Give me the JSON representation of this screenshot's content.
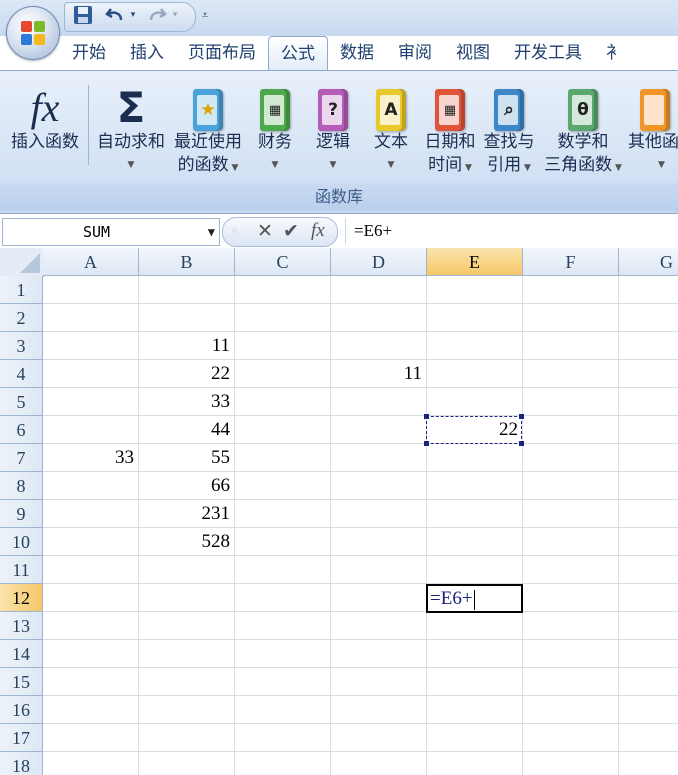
{
  "quick_access": {
    "save_icon": "save-icon",
    "undo_icon": "undo-icon",
    "redo_icon": "redo-icon",
    "customize_icon": "customize-icon"
  },
  "tabs": [
    {
      "label": "开始"
    },
    {
      "label": "插入"
    },
    {
      "label": "页面布局"
    },
    {
      "label": "公式",
      "active": true
    },
    {
      "label": "数据"
    },
    {
      "label": "审阅"
    },
    {
      "label": "视图"
    },
    {
      "label": "开发工具"
    },
    {
      "label": "衤"
    }
  ],
  "ribbon": {
    "group_label": "函数库",
    "buttons": {
      "insert_function": {
        "line1": "插入函数",
        "icon": "fx-icon"
      },
      "autosum": {
        "line1": "自动求和",
        "icon": "sigma-icon"
      },
      "recent": {
        "line1": "最近使用",
        "line2": "的函数",
        "icon": "recent-book-icon"
      },
      "financial": {
        "line1": "财务",
        "icon": "financial-book-icon"
      },
      "logical": {
        "line1": "逻辑",
        "icon": "logical-book-icon",
        "glyph": "?"
      },
      "text": {
        "line1": "文本",
        "icon": "text-book-icon",
        "glyph": "A"
      },
      "datetime": {
        "line1": "日期和",
        "line2": "时间",
        "icon": "datetime-book-icon"
      },
      "lookup": {
        "line1": "查找与",
        "line2": "引用",
        "icon": "lookup-book-icon"
      },
      "math": {
        "line1": "数学和",
        "line2": "三角函数",
        "icon": "math-book-icon",
        "glyph": "θ"
      },
      "more": {
        "line1": "其他函",
        "icon": "more-books-icon"
      }
    }
  },
  "formula_bar": {
    "name_box": "SUM",
    "fx_label": "fx",
    "formula": "=E6+"
  },
  "columns": [
    "A",
    "B",
    "C",
    "D",
    "E",
    "F",
    "G"
  ],
  "selected_column": "E",
  "rows": [
    "1",
    "2",
    "3",
    "4",
    "5",
    "6",
    "7",
    "8",
    "9",
    "10",
    "11",
    "12",
    "13",
    "14",
    "15",
    "16",
    "17",
    "18"
  ],
  "selected_row": "12",
  "cells": {
    "B3": "11",
    "B4": "22",
    "B5": "33",
    "B6": "44",
    "B7": "55",
    "B8": "66",
    "B9": "231",
    "B10": "528",
    "A7": "33",
    "D4": "11",
    "E6": "22"
  },
  "editing": {
    "cell": "E12",
    "text": "=E6+"
  },
  "colors": {
    "accent": "#1a237e",
    "selected_header": "#f6c766",
    "ribbon": "#d7e4f5"
  }
}
